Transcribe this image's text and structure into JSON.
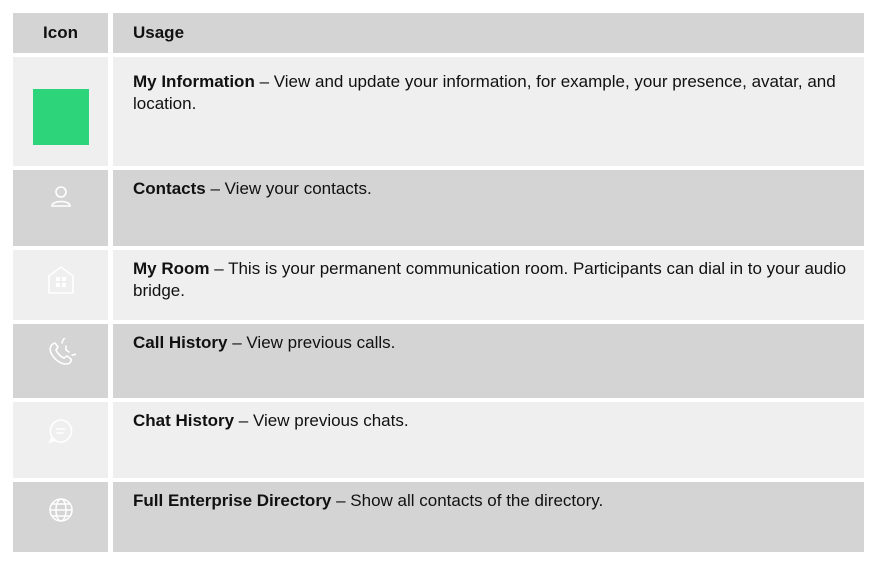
{
  "table": {
    "header": {
      "icon": "Icon",
      "usage": "Usage"
    },
    "rows": [
      {
        "icon": "my-information-icon",
        "title": "My Information",
        "description": " – View and update your information, for example, your presence, avatar, and location."
      },
      {
        "icon": "contacts-icon",
        "title": "Contacts",
        "description": " – View your contacts."
      },
      {
        "icon": "my-room-icon",
        "title": "My Room",
        "description": " – This is your permanent communication room.  Participants can dial in to your audio bridge."
      },
      {
        "icon": "call-history-icon",
        "title": "Call History",
        "description": " – View previous calls."
      },
      {
        "icon": "chat-history-icon",
        "title": "Chat History",
        "description": " – View previous chats."
      },
      {
        "icon": "globe-icon",
        "title": "Full Enterprise Directory",
        "description": " – Show all contacts of the directory."
      }
    ]
  },
  "colors": {
    "header_bg": "#d4d4d4",
    "row_light": "#efefef",
    "row_dark": "#d4d4d4",
    "green": "#2ed47a"
  }
}
